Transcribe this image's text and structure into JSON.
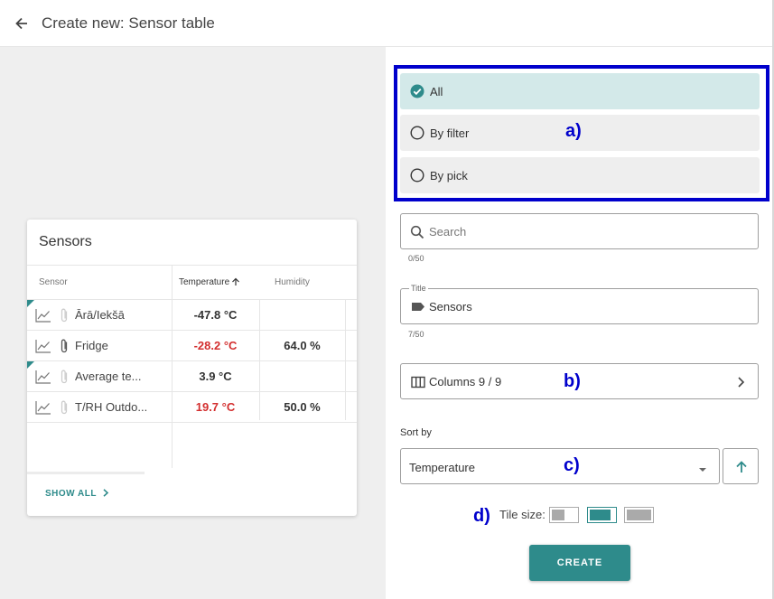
{
  "header": {
    "title": "Create new: Sensor table"
  },
  "preview": {
    "card_title": "Sensors",
    "columns": {
      "sensor": "Sensor",
      "temperature": "Temperature",
      "humidity": "Humidity"
    },
    "rows": [
      {
        "name": "Ārā/Iekšā",
        "temperature": "-47.8 °C",
        "temperature_alert": false,
        "humidity": "",
        "flagged": true
      },
      {
        "name": "Fridge",
        "temperature": "-28.2 °C",
        "temperature_alert": true,
        "humidity": "64.0 %",
        "flagged": false
      },
      {
        "name": "Average te...",
        "temperature": "3.9 °C",
        "temperature_alert": false,
        "humidity": "",
        "flagged": true
      },
      {
        "name": "T/RH Outdo...",
        "temperature": "19.7 °C",
        "temperature_alert": true,
        "humidity": "50.0 %",
        "flagged": false
      }
    ],
    "show_all": "SHOW ALL"
  },
  "selection": {
    "options": [
      {
        "label": "All",
        "selected": true
      },
      {
        "label": "By filter",
        "selected": false
      },
      {
        "label": "By pick",
        "selected": false
      }
    ]
  },
  "annotations": {
    "a": "a)",
    "b": "b)",
    "c": "c)",
    "d": "d)"
  },
  "search": {
    "placeholder": "Search",
    "counter": "0/50"
  },
  "title_field": {
    "legend": "Title",
    "value": "Sensors",
    "counter": "7/50"
  },
  "columns_button": {
    "label": "Columns 9 / 9"
  },
  "sort": {
    "label": "Sort by",
    "value": "Temperature",
    "direction": "ascending"
  },
  "tile_size": {
    "label": "Tile size:",
    "options": [
      "small",
      "medium",
      "large"
    ],
    "selected": "medium"
  },
  "create_button": {
    "label": "CREATE"
  },
  "colors": {
    "accent": "#2e8b8b",
    "alert": "#d32f2f",
    "annotation": "#0000cc",
    "selected_option_bg": "#d3e9e9"
  }
}
